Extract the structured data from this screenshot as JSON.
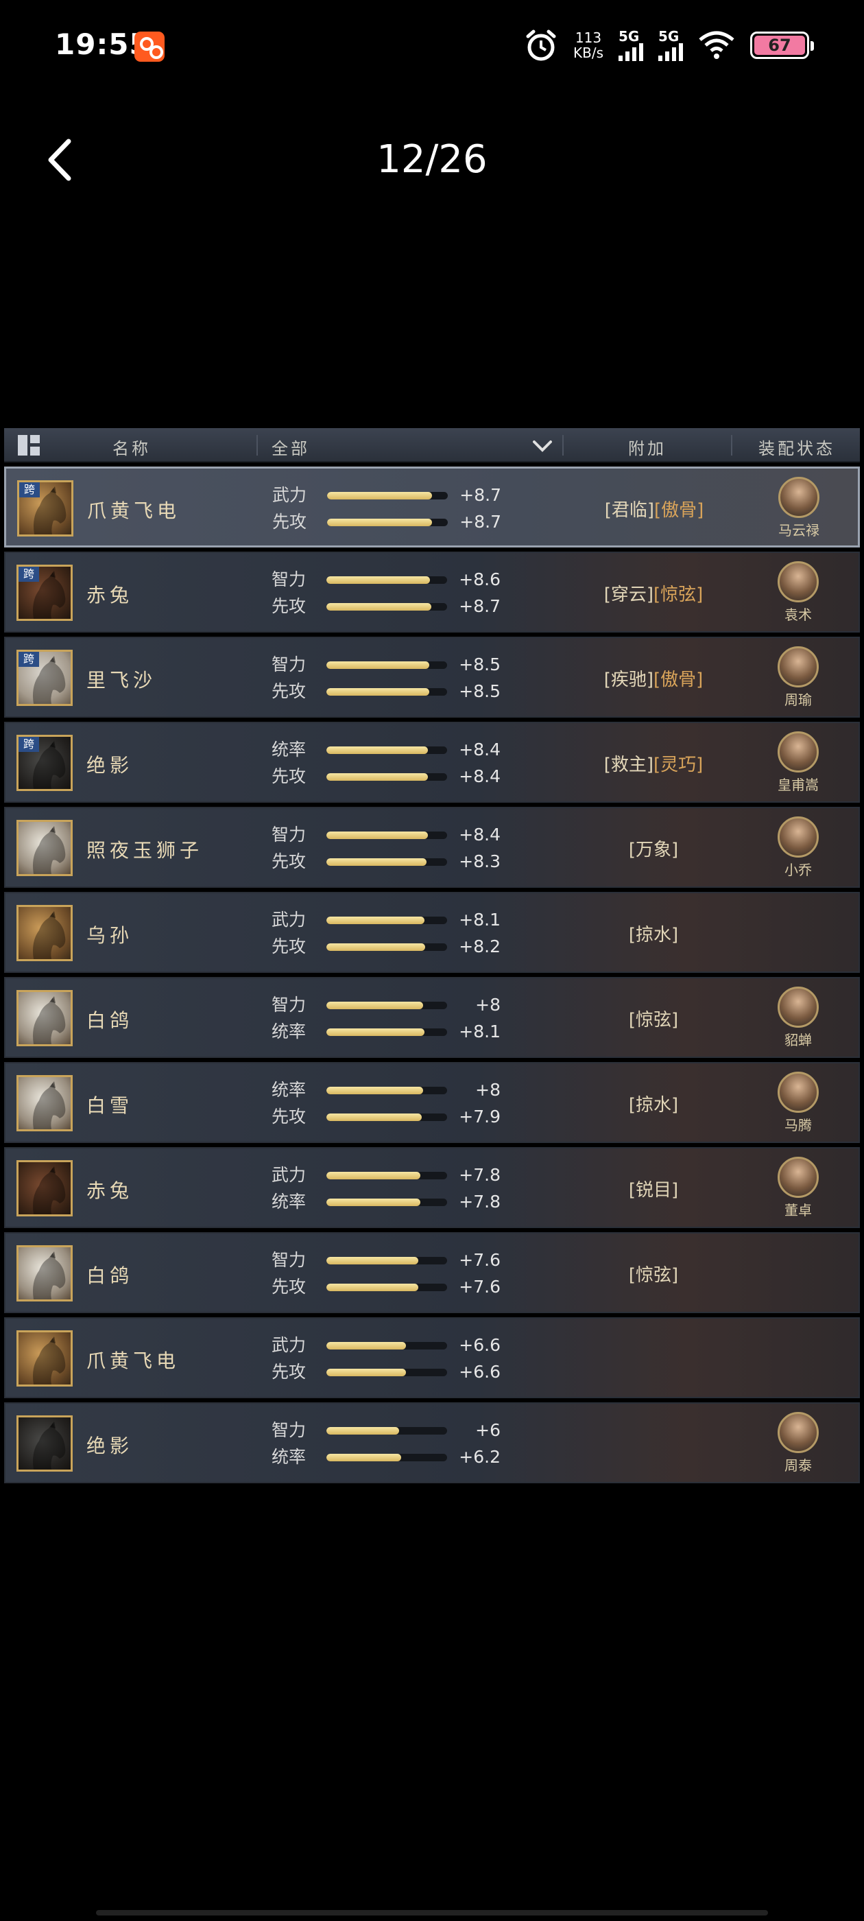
{
  "status_bar": {
    "time": "19:55",
    "app_icon": "kuaishou-app-icon",
    "net_speed_value": "113",
    "net_speed_unit": "KB/s",
    "signal1_label": "5G",
    "signal2_label": "5G",
    "battery": "67",
    "battery_color": "#f27aa2"
  },
  "header": {
    "page_counter": "12/26"
  },
  "table": {
    "columns": {
      "name": "名称",
      "filter": "全部",
      "extra": "附加",
      "status": "装配状态"
    },
    "accent_bar_color": "#e6c66e",
    "tag_color": "#d9a45a",
    "rows": [
      {
        "name": "爪黄飞电",
        "thumb": "horse-tan",
        "kua": "跨",
        "stat1_label": "武力",
        "stat1_value": "+8.7",
        "stat1_fill": 0.87,
        "stat2_label": "先攻",
        "stat2_value": "+8.7",
        "stat2_fill": 0.87,
        "tags": "[君临]",
        "tags2": "[傲骨]",
        "general": "马云禄",
        "selected": true
      },
      {
        "name": "赤兔",
        "thumb": "horse-red",
        "kua": "跨",
        "stat1_label": "智力",
        "stat1_value": "+8.6",
        "stat1_fill": 0.86,
        "stat2_label": "先攻",
        "stat2_value": "+8.7",
        "stat2_fill": 0.87,
        "tags": "[穿云]",
        "tags2": "[惊弦]",
        "general": "袁术"
      },
      {
        "name": "里飞沙",
        "thumb": "horse-grey",
        "kua": "跨",
        "stat1_label": "智力",
        "stat1_value": "+8.5",
        "stat1_fill": 0.85,
        "stat2_label": "先攻",
        "stat2_value": "+8.5",
        "stat2_fill": 0.85,
        "tags": "[疾驰]",
        "tags2": "[傲骨]",
        "general": "周瑜"
      },
      {
        "name": "绝影",
        "thumb": "horse-black",
        "kua": "跨",
        "stat1_label": "统率",
        "stat1_value": "+8.4",
        "stat1_fill": 0.84,
        "stat2_label": "先攻",
        "stat2_value": "+8.4",
        "stat2_fill": 0.84,
        "tags": "[救主]",
        "tags2": "[灵巧]",
        "general": "皇甫嵩"
      },
      {
        "name": "照夜玉狮子",
        "thumb": "horse-white",
        "kua": "",
        "stat1_label": "智力",
        "stat1_value": "+8.4",
        "stat1_fill": 0.84,
        "stat2_label": "先攻",
        "stat2_value": "+8.3",
        "stat2_fill": 0.83,
        "tags": "[万象]",
        "tags2": "",
        "general": "小乔"
      },
      {
        "name": "乌孙",
        "thumb": "horse-tan",
        "kua": "",
        "stat1_label": "武力",
        "stat1_value": "+8.1",
        "stat1_fill": 0.81,
        "stat2_label": "先攻",
        "stat2_value": "+8.2",
        "stat2_fill": 0.82,
        "tags": "[掠水]",
        "tags2": "",
        "general": ""
      },
      {
        "name": "白鸽",
        "thumb": "horse-white",
        "kua": "",
        "stat1_label": "智力",
        "stat1_value": "+8",
        "stat1_fill": 0.8,
        "stat2_label": "统率",
        "stat2_value": "+8.1",
        "stat2_fill": 0.81,
        "tags": "[惊弦]",
        "tags2": "",
        "general": "貂蝉"
      },
      {
        "name": "白雪",
        "thumb": "horse-white",
        "kua": "",
        "stat1_label": "统率",
        "stat1_value": "+8",
        "stat1_fill": 0.8,
        "stat2_label": "先攻",
        "stat2_value": "+7.9",
        "stat2_fill": 0.79,
        "tags": "[掠水]",
        "tags2": "",
        "general": "马腾"
      },
      {
        "name": "赤兔",
        "thumb": "horse-red",
        "kua": "",
        "stat1_label": "武力",
        "stat1_value": "+7.8",
        "stat1_fill": 0.78,
        "stat2_label": "统率",
        "stat2_value": "+7.8",
        "stat2_fill": 0.78,
        "tags": "[锐目]",
        "tags2": "",
        "general": "董卓"
      },
      {
        "name": "白鸽",
        "thumb": "horse-white",
        "kua": "",
        "stat1_label": "智力",
        "stat1_value": "+7.6",
        "stat1_fill": 0.76,
        "stat2_label": "先攻",
        "stat2_value": "+7.6",
        "stat2_fill": 0.76,
        "tags": "[惊弦]",
        "tags2": "",
        "general": ""
      },
      {
        "name": "爪黄飞电",
        "thumb": "horse-tan",
        "kua": "",
        "stat1_label": "武力",
        "stat1_value": "+6.6",
        "stat1_fill": 0.66,
        "stat2_label": "先攻",
        "stat2_value": "+6.6",
        "stat2_fill": 0.66,
        "tags": "",
        "tags2": "",
        "general": ""
      },
      {
        "name": "绝影",
        "thumb": "horse-black",
        "kua": "",
        "stat1_label": "智力",
        "stat1_value": "+6",
        "stat1_fill": 0.6,
        "stat2_label": "统率",
        "stat2_value": "+6.2",
        "stat2_fill": 0.62,
        "tags": "",
        "tags2": "",
        "general": "周泰"
      }
    ]
  }
}
